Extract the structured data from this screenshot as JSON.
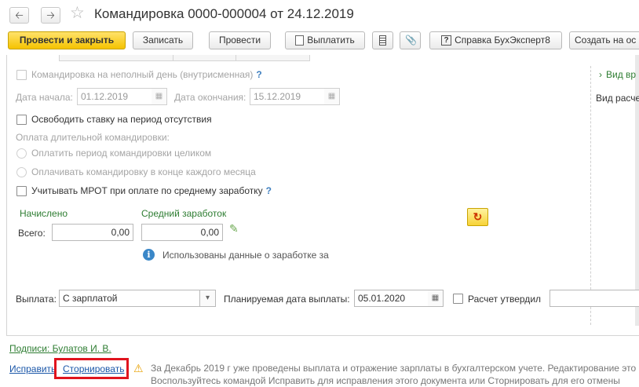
{
  "header": {
    "back_icon": "arrow-left-icon",
    "forward_icon": "arrow-right-icon",
    "favorite_icon": "star-icon",
    "title": "Командировка 0000-000004 от 24.12.2019"
  },
  "toolbar": {
    "post_close": "Провести и закрыть",
    "save": "Записать",
    "post": "Провести",
    "pay": "Выплатить",
    "reference": "Справка БухЭксперт8",
    "create_based": "Создать на ос"
  },
  "form": {
    "partial_day_label": "Командировка на неполный день (внутрисменная)",
    "help_mark": "?",
    "start_date_label": "Дата начала:",
    "start_date_value": "01.12.2019",
    "end_date_label": "Дата окончания:",
    "end_date_value": "15.12.2019",
    "release_rate_label": "Освободить ставку на период отсутствия",
    "long_payment_label": "Оплата длительной командировки:",
    "radio_whole": "Оплатить период командировки целиком",
    "radio_monthly": "Оплачивать командировку в конце каждого месяца",
    "mrot_label": "Учитывать МРОТ при оплате по среднему заработку",
    "accrued_header": "Начислено",
    "avg_earnings_header": "Средний заработок",
    "total_label": "Всего:",
    "accrued_value": "0,00",
    "avg_value": "0,00",
    "info_text": "Использованы данные о заработке за",
    "payout_label": "Выплата:",
    "payout_value": "С зарплатой",
    "planned_date_label": "Планируемая дата выплаты:",
    "planned_date_value": "05.01.2020",
    "calc_approved_label": "Расчет утвердил"
  },
  "right_panel": {
    "expand_label": "Вид вр",
    "calc_label": "Вид расче"
  },
  "footer": {
    "signatures": "Подписи: Булатов И. В.",
    "fix_link": "Исправить",
    "storno_link": "Сторнировать",
    "warning_line1": "За Декабрь 2019 г уже проведены выплата и отражение зарплаты в бухгалтерском учете. Редактирование это",
    "warning_line2": "Воспользуйтесь командой Исправить для исправления этого документа или Сторнировать для его отмены"
  },
  "colors": {
    "primary_button": "#f5c300",
    "link": "#1a56a8",
    "green_text": "#2e7d32",
    "highlight_box": "#e0141e"
  }
}
